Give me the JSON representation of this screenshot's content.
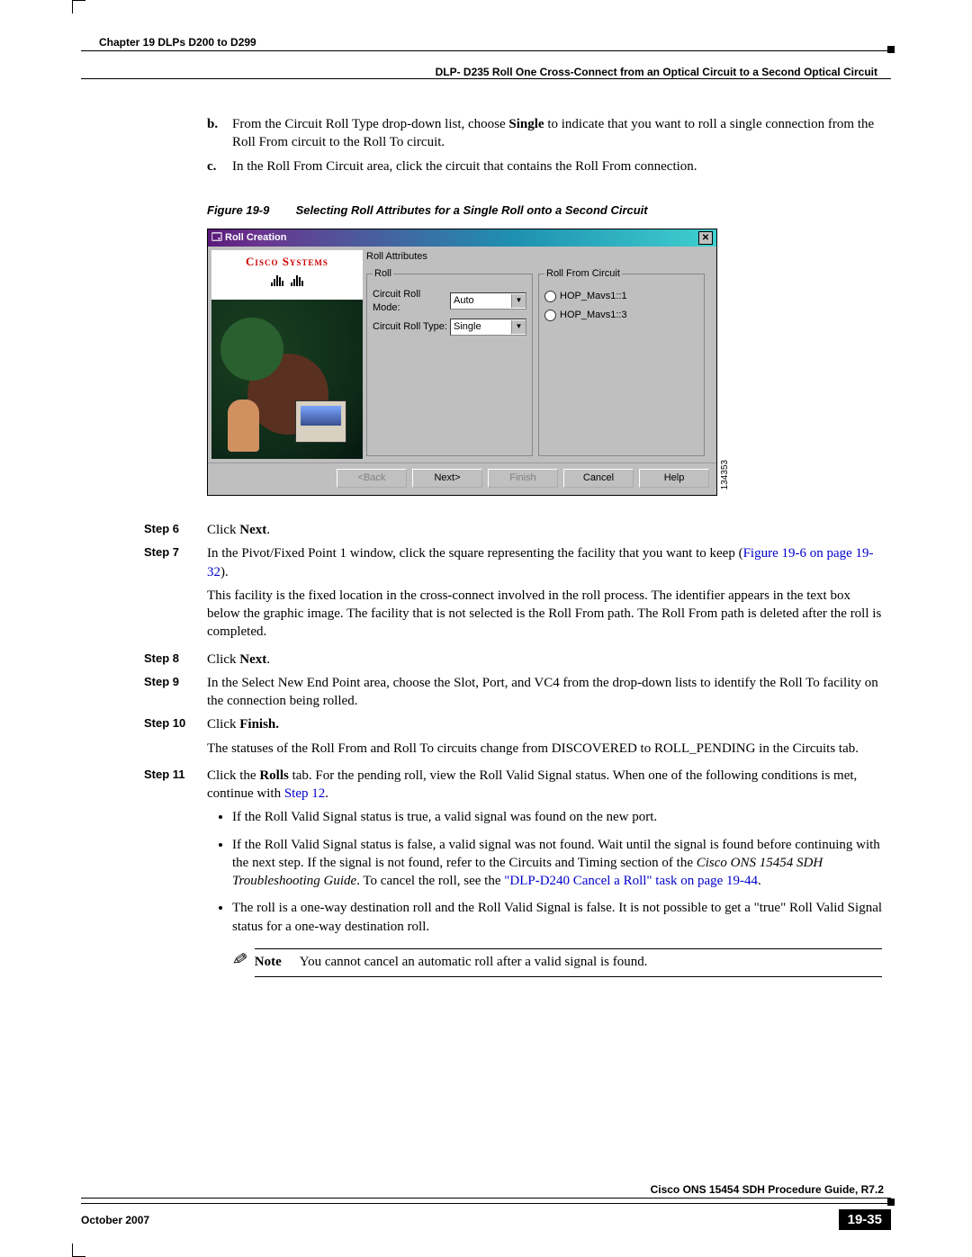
{
  "header": {
    "chapter": "Chapter 19 DLPs D200 to D299",
    "section": "DLP- D235 Roll One Cross-Connect from an Optical Circuit to a Second Optical Circuit"
  },
  "item_b": {
    "label": "b.",
    "text_pre": "From the Circuit Roll Type drop-down list, choose ",
    "bold": "Single",
    "text_post": " to indicate that you want to roll a single connection from the Roll From circuit to the Roll To circuit."
  },
  "item_c": {
    "label": "c.",
    "text": "In the Roll From Circuit area, click the circuit that contains the Roll From connection."
  },
  "figure": {
    "label": "Figure 19-9",
    "caption": "Selecting Roll Attributes for a Single Roll onto a Second Circuit",
    "id_vert": "134353"
  },
  "dialog": {
    "title": "Roll Creation",
    "title_icon": "wizard-icon",
    "brand": "Cisco Systems",
    "group": "Roll Attributes",
    "roll": {
      "legend": "Roll",
      "mode_label": "Circuit Roll Mode:",
      "mode_value": "Auto",
      "type_label": "Circuit Roll Type:",
      "type_value": "Single"
    },
    "from": {
      "legend": "Roll From Circuit",
      "opt1": "HOP_Mavs1::1",
      "opt2": "HOP_Mavs1::3"
    },
    "buttons": {
      "back": "<Back",
      "next": "Next>",
      "finish": "Finish",
      "cancel": "Cancel",
      "help": "Help"
    }
  },
  "step6": {
    "label": "Step 6",
    "pre": "Click ",
    "bold": "Next",
    "post": "."
  },
  "step7": {
    "label": "Step 7",
    "text": "In the Pivot/Fixed Point 1 window, click the square representing the facility that you want to keep (",
    "link": "Figure 19-6 on page 19-32",
    "post": ").",
    "para2": "This facility is the fixed location in the cross-connect involved in the roll process. The identifier appears in the text box below the graphic image. The facility that is not selected is the Roll From path. The Roll From path is deleted after the roll is completed."
  },
  "step8": {
    "label": "Step 8",
    "pre": "Click ",
    "bold": "Next",
    "post": "."
  },
  "step9": {
    "label": "Step 9",
    "text": "In the Select New End Point area, choose the Slot, Port, and VC4 from the drop-down lists to identify the Roll To facility on the connection being rolled."
  },
  "step10": {
    "label": "Step 10",
    "pre": "Click ",
    "bold": "Finish.",
    "para2": "The statuses of the Roll From and Roll To circuits change from DISCOVERED to ROLL_PENDING in the Circuits tab."
  },
  "step11": {
    "label": "Step 11",
    "text1": "Click the ",
    "bold1": "Rolls",
    "text2": " tab. For the pending roll, view the Roll Valid Signal status. When one of the following conditions is met, continue with ",
    "link": "Step 12",
    "text3": "."
  },
  "bullets": {
    "b1": "If the Roll Valid Signal status is true, a valid signal was found on the new port.",
    "b2_a": "If the Roll Valid Signal status is false, a valid signal was not found. Wait until the signal is found before continuing with the next step. If the signal is not found, refer to the Circuits and Timing section of the ",
    "b2_italic": "Cisco ONS 15454 SDH Troubleshooting Guide",
    "b2_b": ". To cancel the roll, see the ",
    "b2_link": "\"DLP-D240 Cancel a Roll\" task on page 19-44",
    "b2_c": ".",
    "b3": "The roll is a one-way destination roll and the Roll Valid Signal is false. It is not possible to get a \"true\" Roll Valid Signal status for a one-way destination roll."
  },
  "note": {
    "label": "Note",
    "text": "You cannot cancel an automatic roll after a valid signal is found."
  },
  "footer": {
    "guide": "Cisco ONS 15454 SDH Procedure Guide, R7.2",
    "date": "October 2007",
    "page": "19-35"
  }
}
